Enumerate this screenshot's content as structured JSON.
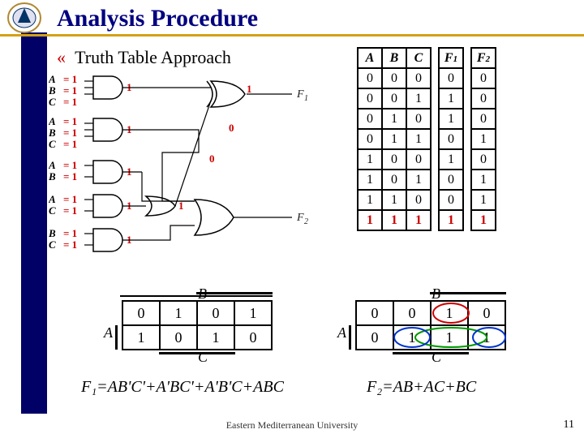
{
  "title": "Analysis Procedure",
  "heading": "Truth Table Approach",
  "bullet_glyph": "«",
  "circuit": {
    "input_labels": [
      "A",
      "B",
      "C"
    ],
    "input_values_col": [
      "= 1",
      "= 1",
      "= 1",
      "= 1",
      "= 1",
      "= 1",
      "= 1",
      "= 1",
      "= 1",
      "= 1",
      "= 1",
      "= 1"
    ],
    "gate_out_values": [
      "1",
      "1",
      "1",
      "1",
      "1"
    ],
    "wire_values": [
      "1",
      "0",
      "0",
      "1"
    ],
    "outputs": [
      "F₁",
      "F₂"
    ]
  },
  "truth_table": {
    "headers": [
      "A",
      "B",
      "C",
      "F",
      "F"
    ],
    "header_subs": [
      "",
      "",
      "",
      "1",
      "2"
    ],
    "rows": [
      {
        "a": 0,
        "b": 0,
        "c": 0,
        "f1": 0,
        "f2": 0,
        "hi": false
      },
      {
        "a": 0,
        "b": 0,
        "c": 1,
        "f1": 1,
        "f2": 0,
        "hi": false
      },
      {
        "a": 0,
        "b": 1,
        "c": 0,
        "f1": 1,
        "f2": 0,
        "hi": false
      },
      {
        "a": 0,
        "b": 1,
        "c": 1,
        "f1": 0,
        "f2": 1,
        "hi": false
      },
      {
        "a": 1,
        "b": 0,
        "c": 0,
        "f1": 1,
        "f2": 0,
        "hi": false
      },
      {
        "a": 1,
        "b": 0,
        "c": 1,
        "f1": 0,
        "f2": 1,
        "hi": false
      },
      {
        "a": 1,
        "b": 1,
        "c": 0,
        "f1": 0,
        "f2": 1,
        "hi": false
      },
      {
        "a": 1,
        "b": 1,
        "c": 1,
        "f1": 1,
        "f2": 1,
        "hi": true
      }
    ]
  },
  "kmap1": {
    "top_label": "B",
    "left_label": "A",
    "bottom_label": "C",
    "cells": [
      [
        "0",
        "1",
        "0",
        "1"
      ],
      [
        "1",
        "0",
        "1",
        "0"
      ]
    ]
  },
  "kmap2": {
    "top_label": "B",
    "left_label": "A",
    "bottom_label": "C",
    "cells": [
      [
        "0",
        "0",
        "1",
        "0"
      ],
      [
        "0",
        "1",
        "1",
        "1"
      ]
    ]
  },
  "equation1": "F₁=AB'C'+A'BC'+A'B'C+ABC",
  "equation2": "F₂=AB+AC+BC",
  "footer": "Eastern Mediterranean University",
  "slide_number": "11",
  "chart_data": {
    "type": "table",
    "title": "Truth Table for F1 and F2",
    "columns": [
      "A",
      "B",
      "C",
      "F1",
      "F2"
    ],
    "rows": [
      [
        0,
        0,
        0,
        0,
        0
      ],
      [
        0,
        0,
        1,
        1,
        0
      ],
      [
        0,
        1,
        0,
        1,
        0
      ],
      [
        0,
        1,
        1,
        0,
        1
      ],
      [
        1,
        0,
        0,
        1,
        0
      ],
      [
        1,
        0,
        1,
        0,
        1
      ],
      [
        1,
        1,
        0,
        0,
        1
      ],
      [
        1,
        1,
        1,
        1,
        1
      ]
    ]
  }
}
